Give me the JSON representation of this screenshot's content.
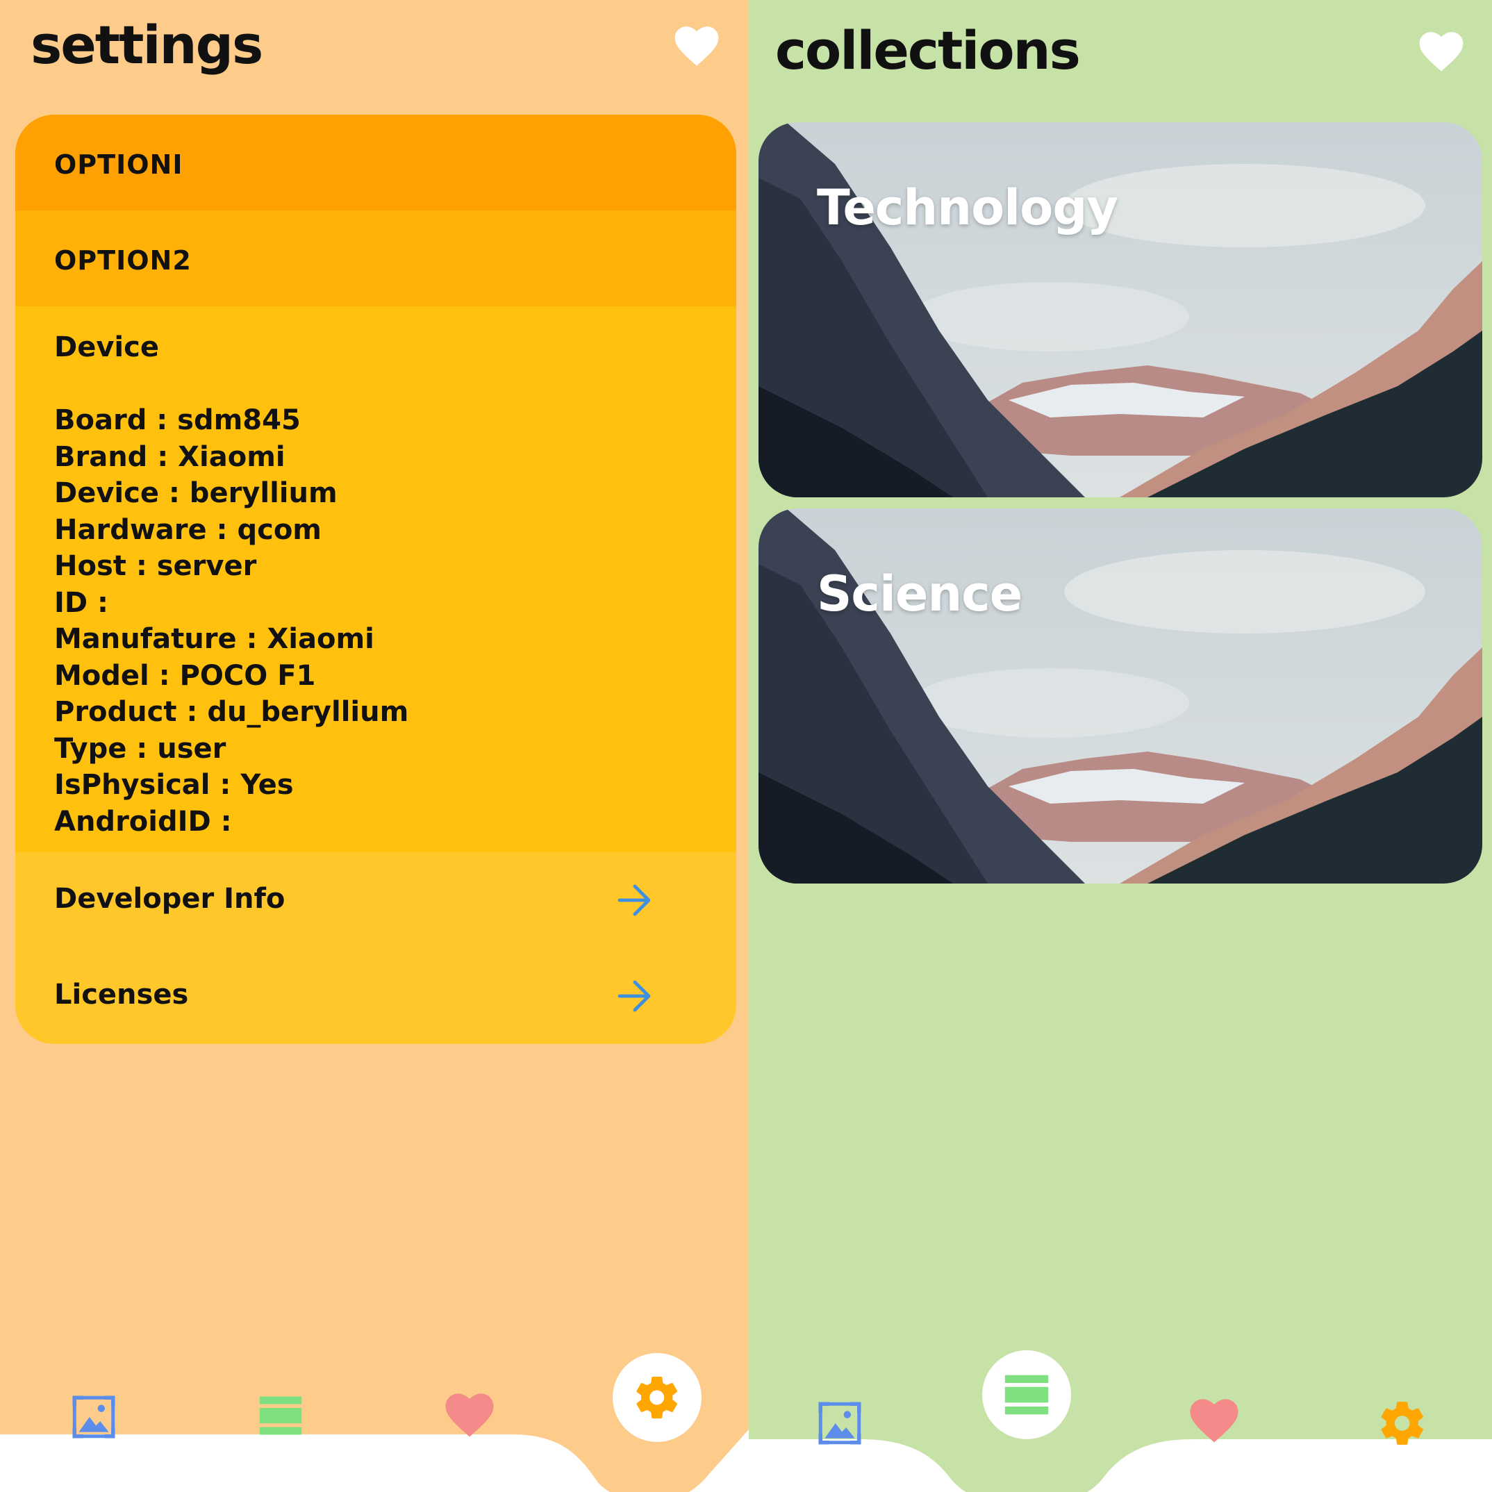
{
  "settings": {
    "title": "settings",
    "option1": "OPTIONI",
    "option2": "OPTION2",
    "device_title": "Device",
    "device_info": [
      "Board : sdm845",
      "Brand : Xiaomi",
      "Device : beryllium",
      "Hardware : qcom",
      "Host : server",
      "ID :",
      "Manufature : Xiaomi",
      "Model : POCO F1",
      "Product : du_beryllium",
      "Type : user",
      "IsPhysical : Yes",
      "AndroidID :"
    ],
    "developer_info": "Developer Info",
    "licenses": "Licenses"
  },
  "collections": {
    "title": "collections",
    "items": [
      "Technology",
      "Science"
    ]
  },
  "navigation": {
    "items": [
      "gallery-icon",
      "collections-icon",
      "favorites-icon",
      "settings-icon"
    ],
    "left_active": "settings-icon",
    "right_active": "collections-icon"
  },
  "colors": {
    "settings_bg": "#FDCC8A",
    "collections_bg": "#C6E2A6",
    "option1": "#FFA103",
    "option2": "#FFB107",
    "device": "#FFC10E",
    "links": "#FFC72A",
    "arrow": "#3D8FE0",
    "gallery_icon": "#5C8DEB",
    "collections_icon": "#7FE07F",
    "heart_icon": "#F48A8A",
    "gear_icon": "#FFA600"
  }
}
